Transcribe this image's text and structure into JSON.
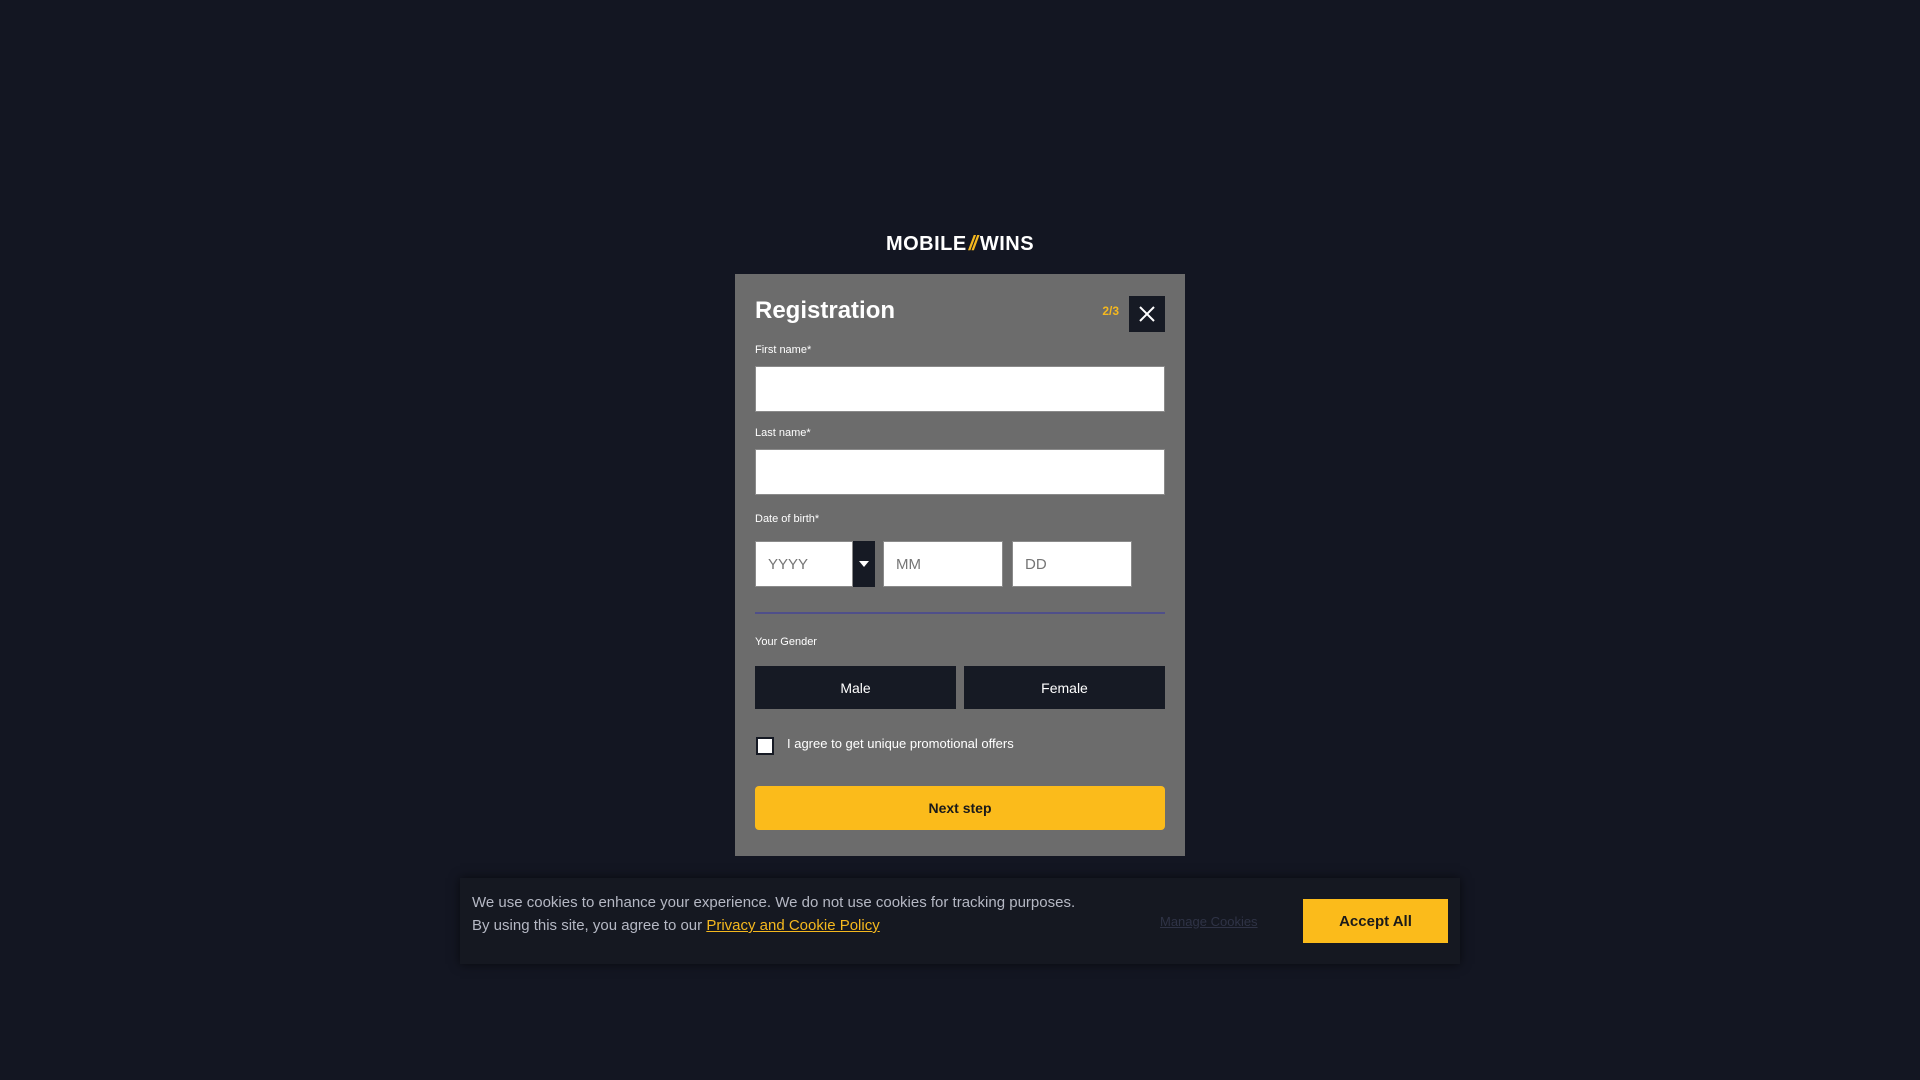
{
  "brand": {
    "logo_left": "MOBILE",
    "logo_mark": "//",
    "logo_right": "WINS",
    "accent_color": "#fbbb1b"
  },
  "registration": {
    "title": "Registration",
    "step": "2/3",
    "close_icon": "close-icon",
    "first_name": {
      "label": "First name*",
      "value": ""
    },
    "last_name": {
      "label": "Last name*",
      "value": ""
    },
    "dob": {
      "label": "Date of birth*",
      "year_placeholder": "YYYY",
      "month_placeholder": "MM",
      "day_placeholder": "DD",
      "year_dropdown_icon": "caret-down-icon"
    },
    "gender": {
      "label": "Your Gender",
      "options": [
        "Male",
        "Female"
      ]
    },
    "promo": {
      "label": "I agree to get unique promotional offers",
      "checked": false
    },
    "next_label": "Next step"
  },
  "cookie_banner": {
    "text_line1": "We use cookies to enhance your experience. We do not use cookies for tracking purposes.",
    "text_line2": "By using this site, you agree to our",
    "policy_link": "Privacy and Cookie Policy",
    "manage_label": "Manage Cookies",
    "accept_label": "Accept All"
  }
}
